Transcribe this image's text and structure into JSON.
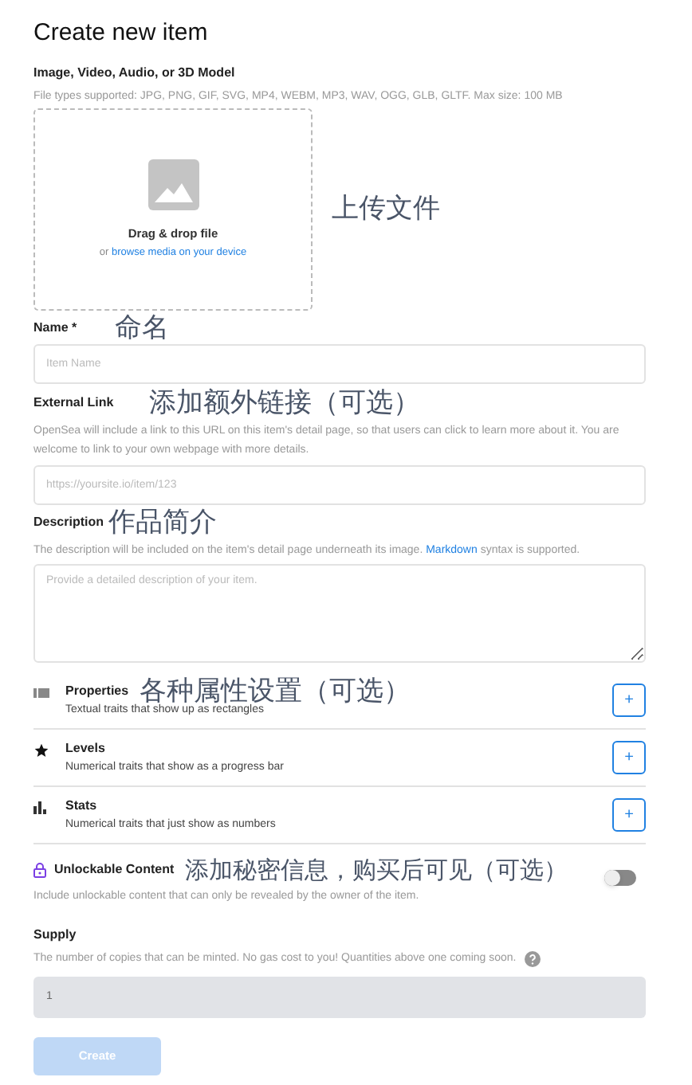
{
  "title": "Create new item",
  "media": {
    "label": "Image, Video, Audio, or 3D Model",
    "hint": "File types supported: JPG, PNG, GIF, SVG, MP4, WEBM, MP3, WAV, OGG, GLB, GLTF. Max size: 100 MB",
    "drop_title": "Drag & drop file",
    "drop_prefix": "or ",
    "drop_link": "browse media on your device",
    "annotation": "上传文件"
  },
  "name": {
    "label": "Name *",
    "annotation": "命名",
    "placeholder": "Item Name"
  },
  "external_link": {
    "label": "External Link",
    "annotation": "添加额外链接（可选）",
    "hint": "OpenSea will include a link to this URL on this item's detail page, so that users can click to learn more about it. You are welcome to link to your own webpage with more details.",
    "placeholder": "https://yoursite.io/item/123"
  },
  "description": {
    "label": "Description",
    "annotation": "作品简介",
    "hint": "The description will be included on the item's detail page underneath its image. ",
    "hint_link": "Markdown",
    "hint_end": " syntax is supported.",
    "placeholder": "Provide a detailed description of your item."
  },
  "traits": [
    {
      "kind": "properties",
      "title": "Properties",
      "subtitle": "Textual traits that show up as rectangles",
      "button": "+",
      "annotation": "各种属性设置（可选）"
    },
    {
      "kind": "levels",
      "title": "Levels",
      "subtitle": "Numerical traits that show as a progress bar",
      "button": "+"
    },
    {
      "kind": "stats",
      "title": "Stats",
      "subtitle": "Numerical traits that just show as numbers",
      "button": "+"
    }
  ],
  "unlockable": {
    "label": "Unlockable Content",
    "annotation": "添加秘密信息，购买后可见（可选）",
    "hint": "Include unlockable content that can only be revealed by the owner of the item.",
    "on": false
  },
  "supply": {
    "label": "Supply",
    "hint": "The number of copies that can be minted. No gas cost to you! Quantities above one coming soon.",
    "value": "1",
    "disabled": true
  },
  "create_button": {
    "label": "Create",
    "disabled": true
  }
}
